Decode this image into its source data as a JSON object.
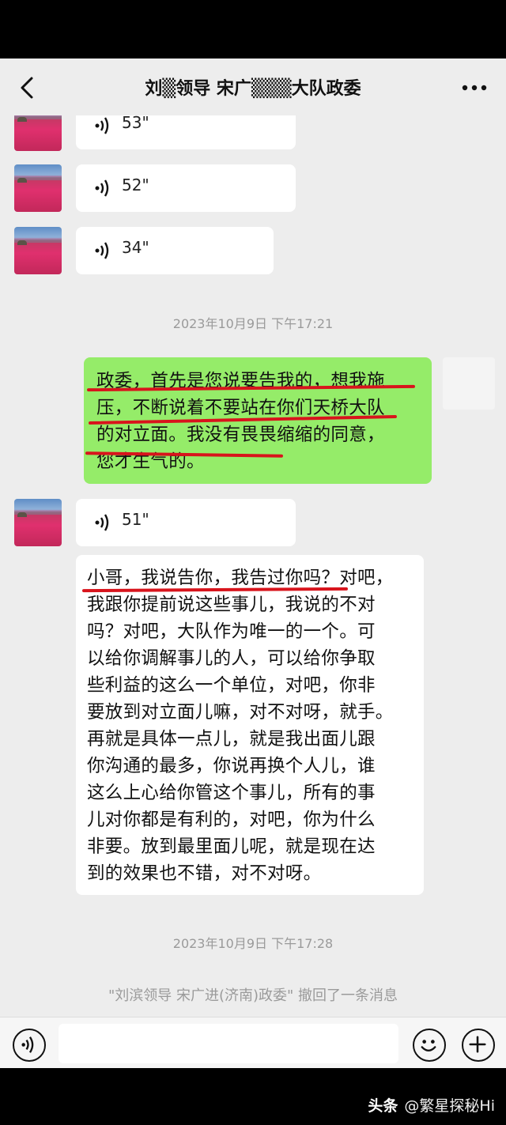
{
  "header": {
    "title": "刘▒领导  宋广▒▒▒大队政委",
    "back_icon": "chevron-left-icon",
    "more_icon": "more-dots-icon"
  },
  "messages": [
    {
      "type": "voice",
      "side": "left",
      "duration": "53\""
    },
    {
      "type": "voice",
      "side": "left",
      "duration": "52\""
    },
    {
      "type": "voice",
      "side": "left",
      "duration": "34\""
    },
    {
      "type": "time",
      "text": "2023年10月9日 下午17:21"
    },
    {
      "type": "text",
      "side": "right",
      "lines": [
        "政委，首先是您说要告我的，想我施",
        "压，不断说着不要站在你们天桥大队",
        "的对立面。我没有畏畏缩缩的同意，",
        "您才生气的。"
      ]
    },
    {
      "type": "voice",
      "side": "left",
      "duration": "51\""
    },
    {
      "type": "text",
      "side": "left",
      "lines": [
        "小哥，我说告你，我告过你吗？对吧，",
        "我跟你提前说这些事儿，我说的不对",
        "吗？对吧，大队作为唯一的一个。可",
        "以给你调解事儿的人，可以给你争取",
        "些利益的这么一个单位，对吧，你非",
        "要放到对立面儿嘛，对不对呀，就手。",
        "再就是具体一点儿，就是我出面儿跟",
        "你沟通的最多，你说再换个人儿，谁",
        "这么上心给你管这个事儿，所有的事",
        "儿对你都是有利的，对吧，你为什么",
        "非要。放到最里面儿呢，就是现在达",
        "到的效果也不错，对不对呀。"
      ]
    },
    {
      "type": "time",
      "text": "2023年10月9日 下午17:28"
    },
    {
      "type": "recall",
      "text": "\"刘滨领导  宋广进(济南)政委\" 撤回了一条消息"
    }
  ],
  "input_bar": {
    "voice_icon": "voice-input-icon",
    "emoji_icon": "emoji-icon",
    "plus_icon": "plus-icon",
    "value": ""
  },
  "watermark": {
    "brand": "头条",
    "account": "@繁星探秘Hi"
  },
  "colors": {
    "background": "#ededed",
    "sent_bubble": "#95ec69",
    "received_bubble": "#ffffff",
    "annotation_red": "#d8141c",
    "timestamp": "#9a9a9a"
  }
}
